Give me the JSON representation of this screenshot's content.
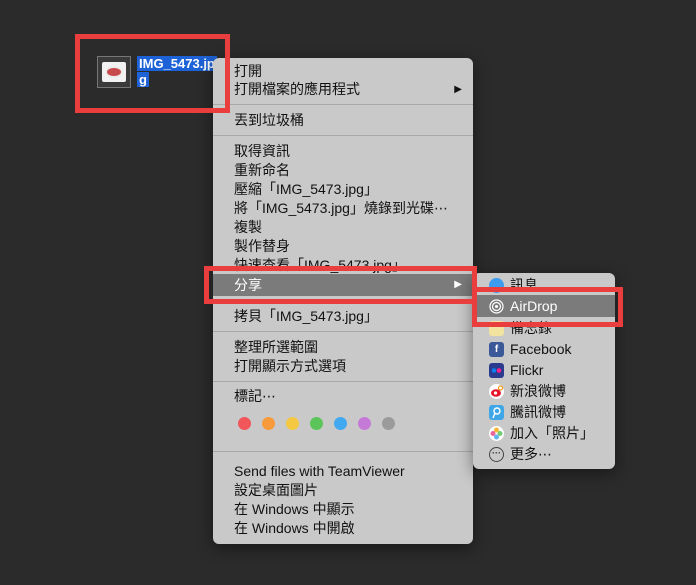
{
  "file": {
    "name_line1": "IMG_5473.jp",
    "name_line2": "g"
  },
  "context_menu": {
    "open": "打開",
    "open_with": "打開檔案的應用程式",
    "move_to_trash": "丟到垃圾桶",
    "get_info": "取得資訊",
    "rename": "重新命名",
    "compress": "壓縮「IMG_5473.jpg」",
    "burn": "將「IMG_5473.jpg」燒錄到光碟⋯",
    "duplicate": "複製",
    "make_alias": "製作替身",
    "quick_look": "快速查看「IMG_5473.jpg」",
    "share": "分享",
    "copy": "拷貝「IMG_5473.jpg」",
    "clean_up": "整理所選範圍",
    "view_options": "打開顯示方式選項",
    "tags": "標記⋯",
    "teamviewer": "Send files with TeamViewer",
    "set_desktop": "設定桌面圖片",
    "show_in_windows": "在 Windows 中顯示",
    "open_in_windows": "在 Windows 中開啟",
    "submenu_arrow": "▶"
  },
  "tag_colors": [
    "#f0565a",
    "#f79a3c",
    "#f4c843",
    "#5bc55a",
    "#42a8f0",
    "#c57ad8",
    "#9b9b9b"
  ],
  "share_menu": {
    "messages": "訊息",
    "airdrop": "AirDrop",
    "notes": "備忘錄",
    "facebook": "Facebook",
    "flickr": "Flickr",
    "sina_weibo": "新浪微博",
    "tencent_weibo": "騰訊微博",
    "add_to_photos": "加入「照片」",
    "more": "更多⋯"
  },
  "colors": {
    "highlight": "#ea3d3d",
    "selection": "#1d62d6",
    "menu_bg": "#c9c9c9",
    "active_item": "#7b7b7b"
  }
}
